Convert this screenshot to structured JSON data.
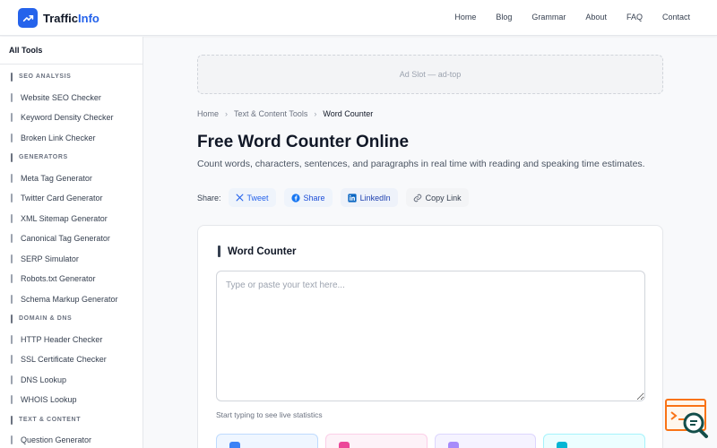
{
  "brand": {
    "name_main": "Traffic",
    "name_accent": "Info",
    "accent_color": "#2563eb"
  },
  "nav": [
    "Home",
    "Blog",
    "Grammar",
    "About",
    "FAQ",
    "Contact"
  ],
  "sidebar": {
    "title": "All Tools",
    "sections": [
      {
        "category": "SEO ANALYSIS",
        "items": [
          "Website SEO Checker",
          "Keyword Density Checker",
          "Broken Link Checker"
        ]
      },
      {
        "category": "GENERATORS",
        "items": [
          "Meta Tag Generator",
          "Twitter Card Generator",
          "XML Sitemap Generator",
          "Canonical Tag Generator",
          "SERP Simulator",
          "Robots.txt Generator",
          "Schema Markup Generator"
        ]
      },
      {
        "category": "DOMAIN & DNS",
        "items": [
          "HTTP Header Checker",
          "SSL Certificate Checker",
          "DNS Lookup",
          "WHOIS Lookup"
        ]
      },
      {
        "category": "TEXT & CONTENT",
        "items": [
          "Question Generator"
        ]
      }
    ]
  },
  "ad": {
    "label": "Ad Slot — ad-top"
  },
  "breadcrumb": {
    "home": "Home",
    "section": "Text & Content Tools",
    "current": "Word Counter"
  },
  "page": {
    "title": "Free Word Counter Online",
    "subtitle": "Count words, characters, sentences, and paragraphs in real time with reading and speaking time estimates."
  },
  "share": {
    "label": "Share:",
    "tweet": "Tweet",
    "facebook": "Share",
    "linkedin": "LinkedIn",
    "copy": "Copy Link"
  },
  "tool": {
    "title": "Word Counter",
    "placeholder": "Type or paste your text here...",
    "hint": "Start typing to see live statistics"
  },
  "stat_colors": [
    {
      "bg": "#eff6ff",
      "border": "#bfdbfe",
      "dot": "#3b82f6"
    },
    {
      "bg": "#fdf2f8",
      "border": "#fbcfe8",
      "dot": "#ec4899"
    },
    {
      "bg": "#f5f3ff",
      "border": "#ddd6fe",
      "dot": "#a78bfa"
    },
    {
      "bg": "#ecfeff",
      "border": "#a5f3fc",
      "dot": "#06b6d4"
    }
  ]
}
